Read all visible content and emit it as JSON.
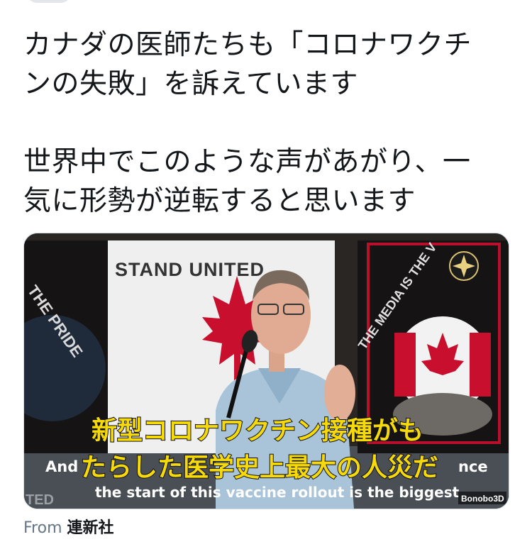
{
  "tweet": {
    "text_lines_p1": [
      "カナダの医師たちも「コロナワクチ",
      "ンの失敗」を訴えています"
    ],
    "text_lines_p2": [
      "世界中でこのような声があがり、一",
      "気に形勢が逆転すると思います"
    ]
  },
  "media": {
    "banner_center": "STAND UNITED",
    "banner_left": "THE PRIDE",
    "banner_right": "THE MEDIA IS THE V",
    "bottom_left_fragment": "TED",
    "subtitle_jp_line1": "新型コロナワクチン接種がも",
    "subtitle_jp_line2": "たらした医学史上最大の人災だ",
    "subtitle_en_line1_left": "And",
    "subtitle_en_line1_right": "nce",
    "subtitle_en_line2": "the start of this vaccine rollout is the biggest",
    "watermark": "Bonobo3D"
  },
  "footer": {
    "from_label": "From",
    "via_name": "連新社"
  },
  "colors": {
    "subtitle_jp_fill": "#f5d90a",
    "flag_red": "#c8102e",
    "text_primary": "#14171a",
    "text_secondary": "#657786"
  }
}
